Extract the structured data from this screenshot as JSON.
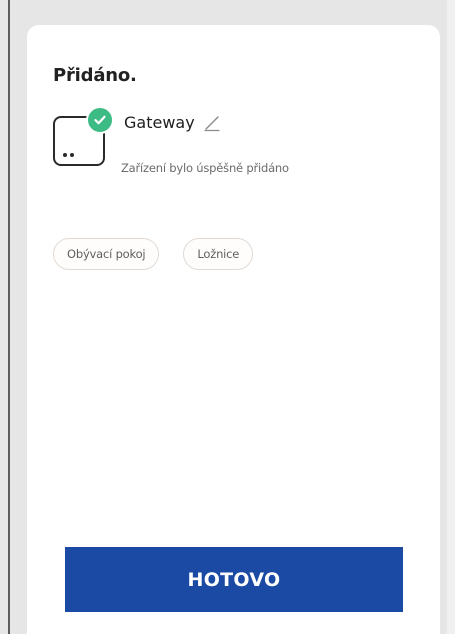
{
  "header": {
    "title": "Přidáno."
  },
  "device": {
    "name": "Gateway",
    "status": "Zařízení bylo úspěšně přidáno",
    "icon": "device-box-icon",
    "badge_icon": "check-circle-icon",
    "badge_color": "#3dbb84"
  },
  "rooms": [
    {
      "label": "Obývací pokoj"
    },
    {
      "label": "Ložnice"
    }
  ],
  "actions": {
    "done_label": "HOTOVO",
    "done_color": "#1a4aa3"
  }
}
